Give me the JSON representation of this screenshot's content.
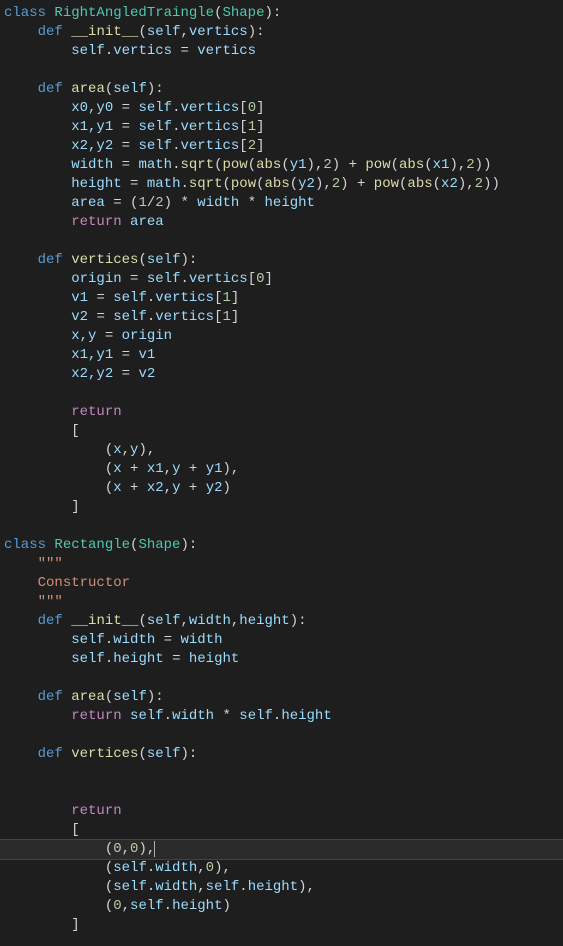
{
  "code": {
    "class1_name": "RightAngledTraingle",
    "class1_base": "Shape",
    "class2_name": "Rectangle",
    "class2_base": "Shape",
    "init_method": "__init__",
    "area_method": "area",
    "vertices_method": "vertices",
    "docstring_quotes": "\"\"\"",
    "docstring_text": "Constructor",
    "self_kw": "self",
    "def_kw": "def",
    "class_kw": "class",
    "return_kw": "return",
    "vertics_param": "vertics",
    "width_param": "width",
    "height_param": "height",
    "vertics_attr": "vertics",
    "width_attr": "width",
    "height_attr": "height",
    "x0y0": "x0,y0",
    "x1y1": "x1,y1",
    "x2y2": "x2,y2",
    "width_var": "width",
    "height_var": "height",
    "area_var": "area",
    "origin_var": "origin",
    "v1_var": "v1",
    "v2_var": "v2",
    "xy_var": "x,y",
    "x_var": "x",
    "y_var": "y",
    "x1_var": "x1",
    "y1_var": "y1",
    "x2_var": "x2",
    "y2_var": "y2",
    "math_mod": "math",
    "sqrt_fn": "sqrt",
    "pow_fn": "pow",
    "abs_fn": "abs",
    "idx0": "0",
    "idx1": "1",
    "idx2": "2",
    "num0": "0",
    "num1": "1",
    "num2": "2"
  }
}
